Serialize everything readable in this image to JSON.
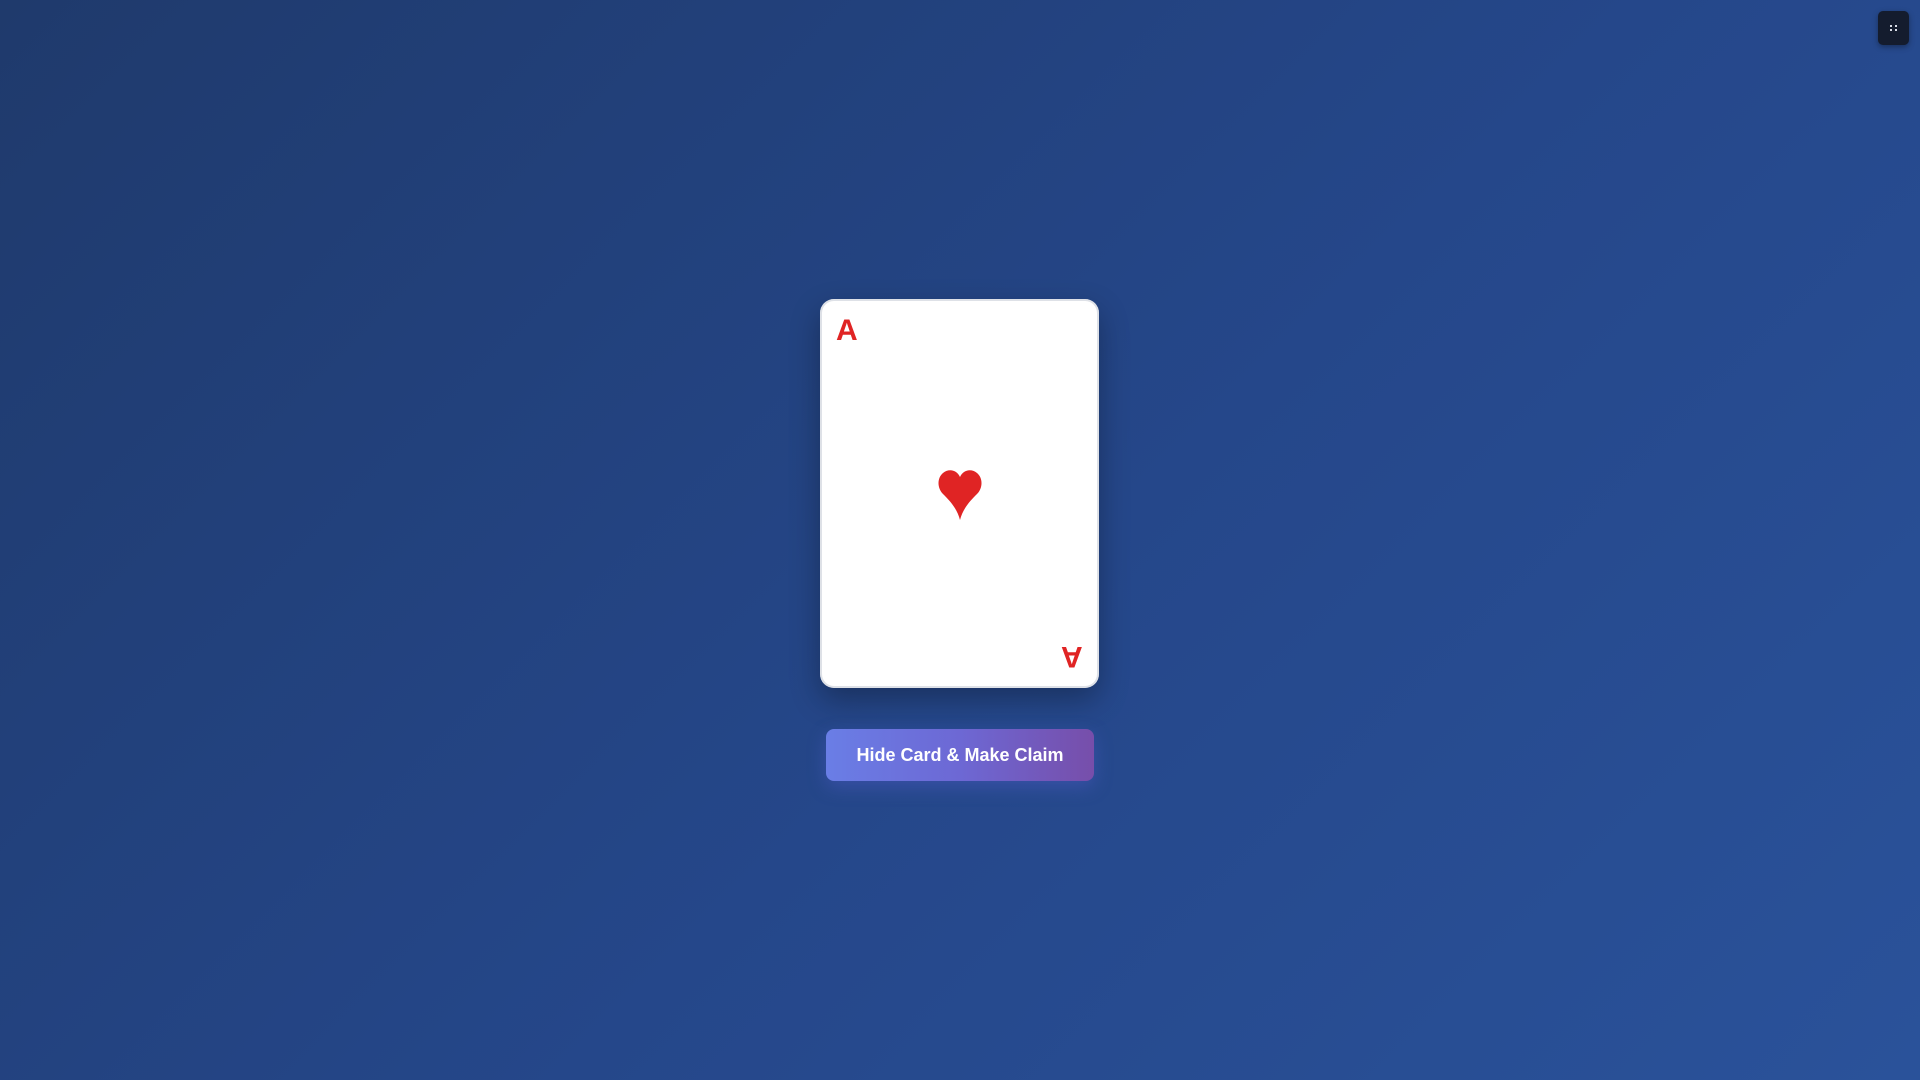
{
  "menu": {
    "icon": "grid-dots-icon"
  },
  "card": {
    "rank": "A",
    "suit": "hearts",
    "suit_icon": "heart-icon",
    "color": "#e02424"
  },
  "actions": {
    "hide_claim_label": "Hide Card & Make Claim"
  }
}
